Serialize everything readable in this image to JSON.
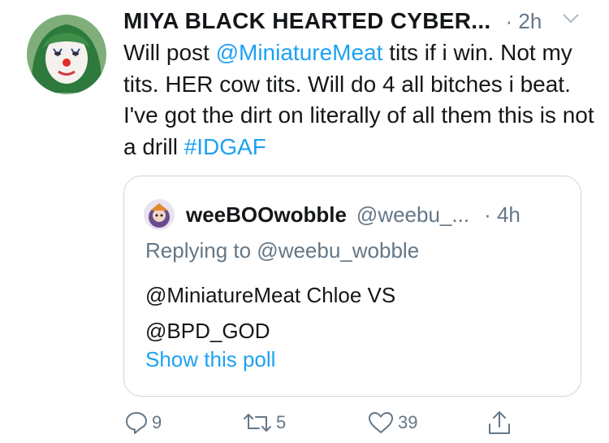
{
  "tweet": {
    "display_name": "MIYA BLACK HEARTED CYBER...",
    "timestamp": "· 2h",
    "body": {
      "p1": "Will post ",
      "mention": "@MiniatureMeat",
      "p2": " tits if i win. Not my tits. HER  cow tits. Will do 4 all bitches i beat. I've got the dirt on literally of all them this is not a drill ",
      "hashtag": "#IDGAF"
    }
  },
  "quoted_tweet": {
    "display_name": "weeBOOwobble",
    "handle": "@weebu_...",
    "timestamp": "· 4h",
    "replying_to": "Replying to @weebu_wobble",
    "body_line1": "@MiniatureMeat Chloe VS",
    "body_line2": "@BPD_GOD",
    "poll_link": "Show this poll"
  },
  "actions": {
    "reply_count": "9",
    "retweet_count": "5",
    "like_count": "39"
  },
  "colors": {
    "link": "#1da1f2",
    "secondary_text": "#657786",
    "border": "#ccd6dd"
  }
}
